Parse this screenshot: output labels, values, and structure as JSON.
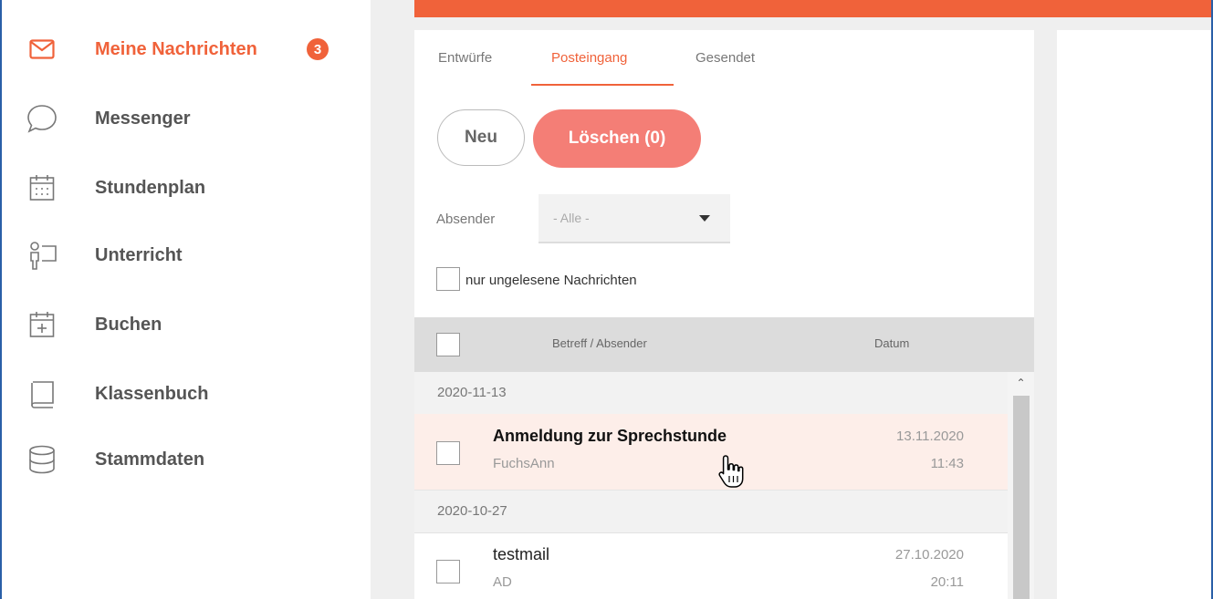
{
  "sidebar": {
    "items": [
      {
        "label": "Meine Nachrichten",
        "icon": "envelope-icon",
        "active": true,
        "badge": "3"
      },
      {
        "label": "Messenger",
        "icon": "speech-bubble-icon"
      },
      {
        "label": "Stundenplan",
        "icon": "calendar-grid-icon"
      },
      {
        "label": "Unterricht",
        "icon": "teacher-board-icon"
      },
      {
        "label": "Buchen",
        "icon": "calendar-plus-icon"
      },
      {
        "label": "Klassenbuch",
        "icon": "book-icon"
      },
      {
        "label": "Stammdaten",
        "icon": "database-icon"
      }
    ]
  },
  "tabs": [
    {
      "label": "Entwürfe"
    },
    {
      "label": "Posteingang",
      "active": true
    },
    {
      "label": "Gesendet"
    }
  ],
  "buttons": {
    "new": "Neu",
    "delete": "Löschen (0)"
  },
  "filter": {
    "sender_label": "Absender",
    "sender_value": "- Alle -",
    "unread_only_label": "nur ungelesene Nachrichten"
  },
  "table": {
    "col_subject": "Betreff / Absender",
    "col_date": "Datum"
  },
  "messages": {
    "groups": [
      {
        "date": "2020-11-13",
        "rows": [
          {
            "subject": "Anmeldung zur Sprechstunde",
            "sender": "FuchsAnn",
            "date": "13.11.2020",
            "time": "11:43",
            "unread": true
          }
        ]
      },
      {
        "date": "2020-10-27",
        "rows": [
          {
            "subject": "testmail",
            "sender": "AD",
            "date": "27.10.2020",
            "time": "20:11",
            "unread": false
          }
        ]
      }
    ]
  },
  "colors": {
    "accent": "#f0623a",
    "delete_button": "#f47e76",
    "hover_row": "#fdeee9",
    "frame": "#2a5fa8"
  }
}
